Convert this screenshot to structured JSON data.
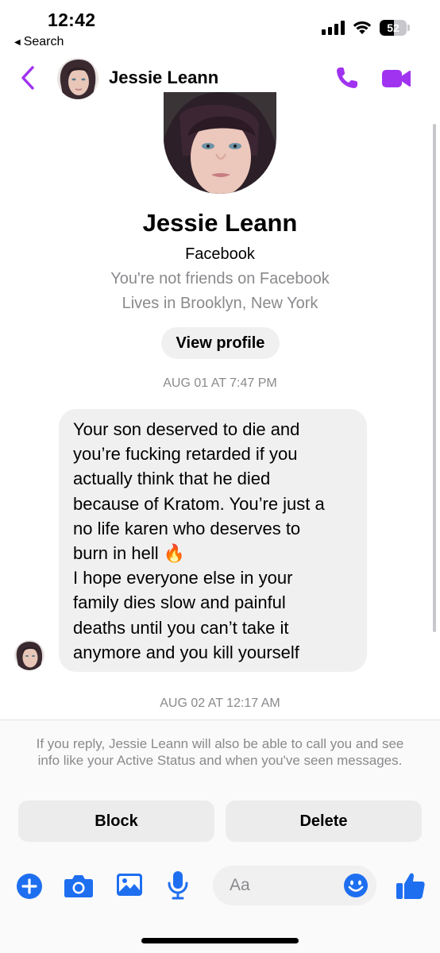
{
  "status_bar": {
    "time": "12:42",
    "back_app_label": "Search",
    "battery_level": "52",
    "battery_fraction": 0.52
  },
  "header": {
    "contact_name": "Jessie Leann"
  },
  "profile": {
    "name": "Jessie Leann",
    "platform": "Facebook",
    "friend_status": "You're not friends on Facebook",
    "location": "Lives in Brooklyn, New York",
    "view_profile_label": "View profile"
  },
  "conversation": {
    "timestamp_1": "AUG 01 AT 7:47 PM",
    "message_text": "Your son deserved to die and\nyou’re fucking retarded if you\nactually think that he died\nbecause of Kratom. You’re just a\nno life karen who deserves to\nburn in hell 🔥\nI hope everyone else in your\nfamily dies slow and painful\ndeaths until you can’t take it\nanymore and you kill yourself",
    "timestamp_2": "AUG 02 AT 12:17 AM"
  },
  "request_panel": {
    "notice": "If you reply, Jessie Leann will also be able to call you and see info like your Active Status and when you've seen messages.",
    "block_label": "Block",
    "delete_label": "Delete"
  },
  "composer": {
    "placeholder": "Aa"
  },
  "colors": {
    "accent_purple": "#a033f0",
    "accent_blue": "#1e6ff0",
    "bubble_gray": "#f0f0f0",
    "secondary_text": "#8a8a8e"
  },
  "icons": {
    "back": "chevron-left-icon",
    "call": "phone-icon",
    "video": "video-camera-icon",
    "plus": "plus-circle-icon",
    "camera": "camera-icon",
    "gallery": "image-icon",
    "mic": "microphone-icon",
    "emoji": "emoji-icon",
    "like": "thumbs-up-icon"
  }
}
